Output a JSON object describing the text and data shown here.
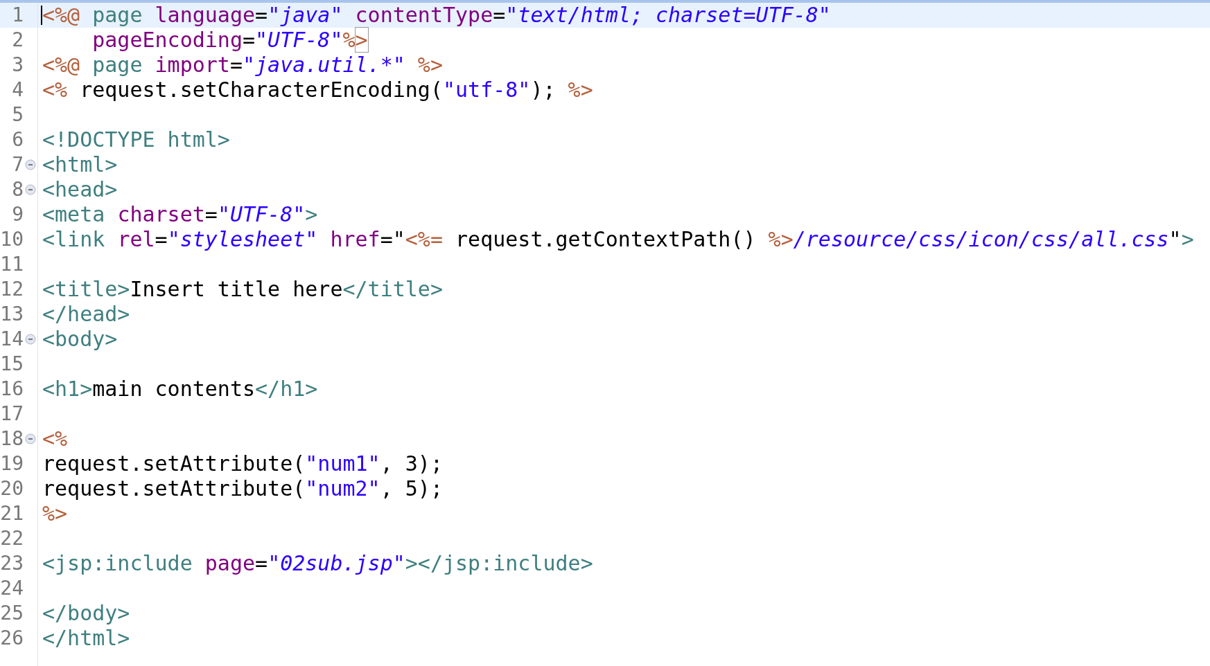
{
  "editor": {
    "lines": [
      {
        "number": "1",
        "fold": false,
        "current": true,
        "tokens": [
          {
            "kind": "delim",
            "text": "<%@"
          },
          {
            "kind": "directive",
            "text": " page "
          },
          {
            "kind": "attr",
            "text": "language"
          },
          {
            "kind": "plain",
            "text": "="
          },
          {
            "kind": "value",
            "text": "\"java\""
          },
          {
            "kind": "attr",
            "text": " contentType"
          },
          {
            "kind": "plain",
            "text": "="
          },
          {
            "kind": "value",
            "text": "\"text/html; charset=UTF-8\""
          }
        ]
      },
      {
        "number": "2",
        "fold": false,
        "current": false,
        "tokens": [
          {
            "kind": "attr",
            "text": "    pageEncoding"
          },
          {
            "kind": "plain",
            "text": "="
          },
          {
            "kind": "value",
            "text": "\"UTF-8\""
          },
          {
            "kind": "delim",
            "text": "%"
          },
          {
            "kind": "delim-matched",
            "text": ">"
          }
        ]
      },
      {
        "number": "3",
        "fold": false,
        "current": false,
        "tokens": [
          {
            "kind": "delim",
            "text": "<%@"
          },
          {
            "kind": "directive",
            "text": " page "
          },
          {
            "kind": "attr",
            "text": "import"
          },
          {
            "kind": "plain",
            "text": "="
          },
          {
            "kind": "value",
            "text": "\"java.util.*\""
          },
          {
            "kind": "delim",
            "text": " %>"
          }
        ]
      },
      {
        "number": "4",
        "fold": false,
        "current": false,
        "tokens": [
          {
            "kind": "delim",
            "text": "<%"
          },
          {
            "kind": "plain",
            "text": " request.setCharacterEncoding("
          },
          {
            "kind": "string",
            "text": "\"utf-8\""
          },
          {
            "kind": "plain",
            "text": "); "
          },
          {
            "kind": "delim",
            "text": "%>"
          }
        ]
      },
      {
        "number": "5",
        "fold": false,
        "current": false
      },
      {
        "number": "6",
        "fold": false,
        "current": false,
        "tokens": [
          {
            "kind": "tag",
            "text": "<!DOCTYPE html>"
          }
        ]
      },
      {
        "number": "7",
        "fold": true,
        "current": false,
        "tokens": [
          {
            "kind": "tag",
            "text": "<html>"
          }
        ]
      },
      {
        "number": "8",
        "fold": true,
        "current": false,
        "tokens": [
          {
            "kind": "tag",
            "text": "<head>"
          }
        ]
      },
      {
        "number": "9",
        "fold": false,
        "current": false,
        "tokens": [
          {
            "kind": "tag",
            "text": "<meta "
          },
          {
            "kind": "attr",
            "text": "charset"
          },
          {
            "kind": "plain",
            "text": "="
          },
          {
            "kind": "value",
            "text": "\"UTF-8\""
          },
          {
            "kind": "tag",
            "text": ">"
          }
        ]
      },
      {
        "number": "10",
        "fold": false,
        "current": false,
        "tokens": [
          {
            "kind": "tag",
            "text": "<link "
          },
          {
            "kind": "attr",
            "text": "rel"
          },
          {
            "kind": "plain",
            "text": "="
          },
          {
            "kind": "value",
            "text": "\"stylesheet\""
          },
          {
            "kind": "attr",
            "text": " href"
          },
          {
            "kind": "plain",
            "text": "=\""
          },
          {
            "kind": "delim",
            "text": "<%="
          },
          {
            "kind": "plain",
            "text": " request.getContextPath() "
          },
          {
            "kind": "delim",
            "text": "%>"
          },
          {
            "kind": "value",
            "text": "/resource/css/icon/css/all.css"
          },
          {
            "kind": "plain",
            "text": "\""
          },
          {
            "kind": "tag",
            "text": ">"
          }
        ]
      },
      {
        "number": "11",
        "fold": false,
        "current": false
      },
      {
        "number": "12",
        "fold": false,
        "current": false,
        "tokens": [
          {
            "kind": "tag",
            "text": "<title>"
          },
          {
            "kind": "plain",
            "text": "Insert title here"
          },
          {
            "kind": "tag",
            "text": "</title>"
          }
        ]
      },
      {
        "number": "13",
        "fold": false,
        "current": false,
        "tokens": [
          {
            "kind": "tag",
            "text": "</head>"
          }
        ]
      },
      {
        "number": "14",
        "fold": true,
        "current": false,
        "tokens": [
          {
            "kind": "tag",
            "text": "<body>"
          }
        ]
      },
      {
        "number": "15",
        "fold": false,
        "current": false
      },
      {
        "number": "16",
        "fold": false,
        "current": false,
        "tokens": [
          {
            "kind": "tag",
            "text": "<h1>"
          },
          {
            "kind": "plain",
            "text": "main contents"
          },
          {
            "kind": "tag",
            "text": "</h1>"
          }
        ]
      },
      {
        "number": "17",
        "fold": false,
        "current": false
      },
      {
        "number": "18",
        "fold": true,
        "current": false,
        "tokens": [
          {
            "kind": "delim",
            "text": "<%"
          }
        ]
      },
      {
        "number": "19",
        "fold": false,
        "current": false,
        "tokens": [
          {
            "kind": "plain",
            "text": "request.setAttribute("
          },
          {
            "kind": "string",
            "text": "\"num1\""
          },
          {
            "kind": "plain",
            "text": ", 3);"
          }
        ]
      },
      {
        "number": "20",
        "fold": false,
        "current": false,
        "tokens": [
          {
            "kind": "plain",
            "text": "request.setAttribute("
          },
          {
            "kind": "string",
            "text": "\"num2\""
          },
          {
            "kind": "plain",
            "text": ", 5);"
          }
        ]
      },
      {
        "number": "21",
        "fold": false,
        "current": false,
        "tokens": [
          {
            "kind": "delim",
            "text": "%>"
          }
        ]
      },
      {
        "number": "22",
        "fold": false,
        "current": false
      },
      {
        "number": "23",
        "fold": false,
        "current": false,
        "tokens": [
          {
            "kind": "tag",
            "text": "<jsp:include "
          },
          {
            "kind": "attr",
            "text": "page"
          },
          {
            "kind": "plain",
            "text": "="
          },
          {
            "kind": "value",
            "text": "\"02sub.jsp\""
          },
          {
            "kind": "tag",
            "text": "></jsp:include>"
          }
        ]
      },
      {
        "number": "24",
        "fold": false,
        "current": false
      },
      {
        "number": "25",
        "fold": false,
        "current": false,
        "tokens": [
          {
            "kind": "tag",
            "text": "</body>"
          }
        ]
      },
      {
        "number": "26",
        "fold": false,
        "current": false,
        "tokens": [
          {
            "kind": "tag",
            "text": "</html>"
          }
        ]
      }
    ]
  }
}
